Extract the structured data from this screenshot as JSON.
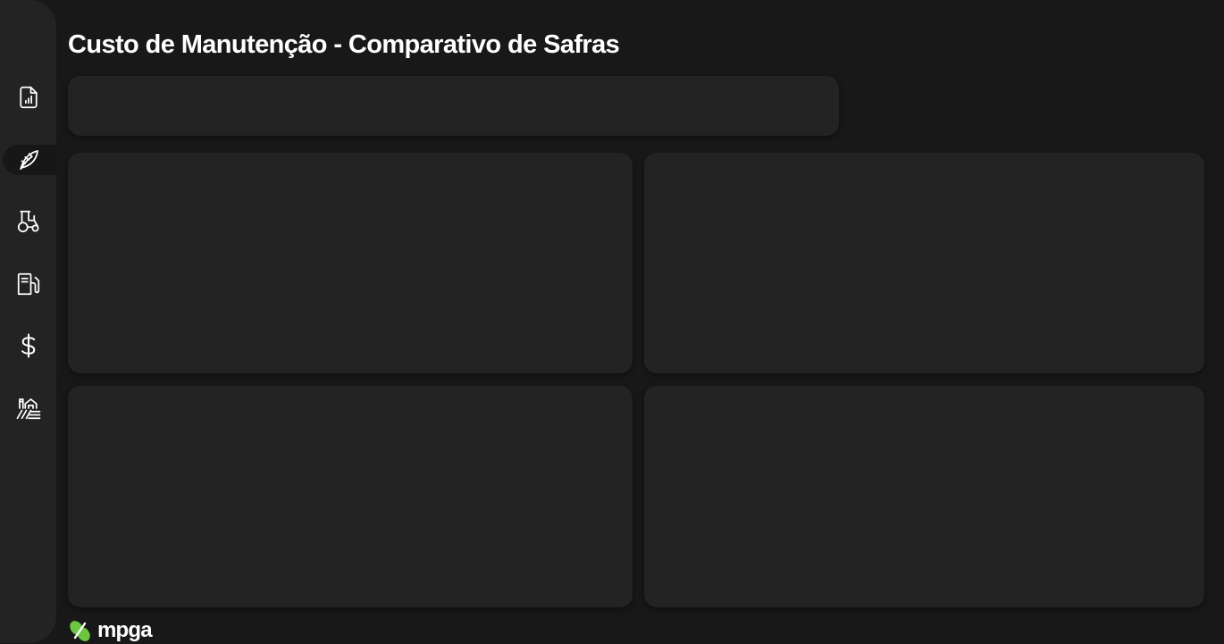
{
  "page": {
    "title": "Custo de Manutenção - Comparativo de Safras"
  },
  "sidebar": {
    "items": [
      {
        "icon": "report-chart-icon",
        "active": false
      },
      {
        "icon": "leaf-icon",
        "active": true
      },
      {
        "icon": "tractor-icon",
        "active": false
      },
      {
        "icon": "fuel-pump-icon",
        "active": false
      },
      {
        "icon": "dollar-icon",
        "active": false
      },
      {
        "icon": "farm-icon",
        "active": false
      }
    ]
  },
  "brand": {
    "name": "mpga",
    "accent_color": "#6cc644"
  }
}
